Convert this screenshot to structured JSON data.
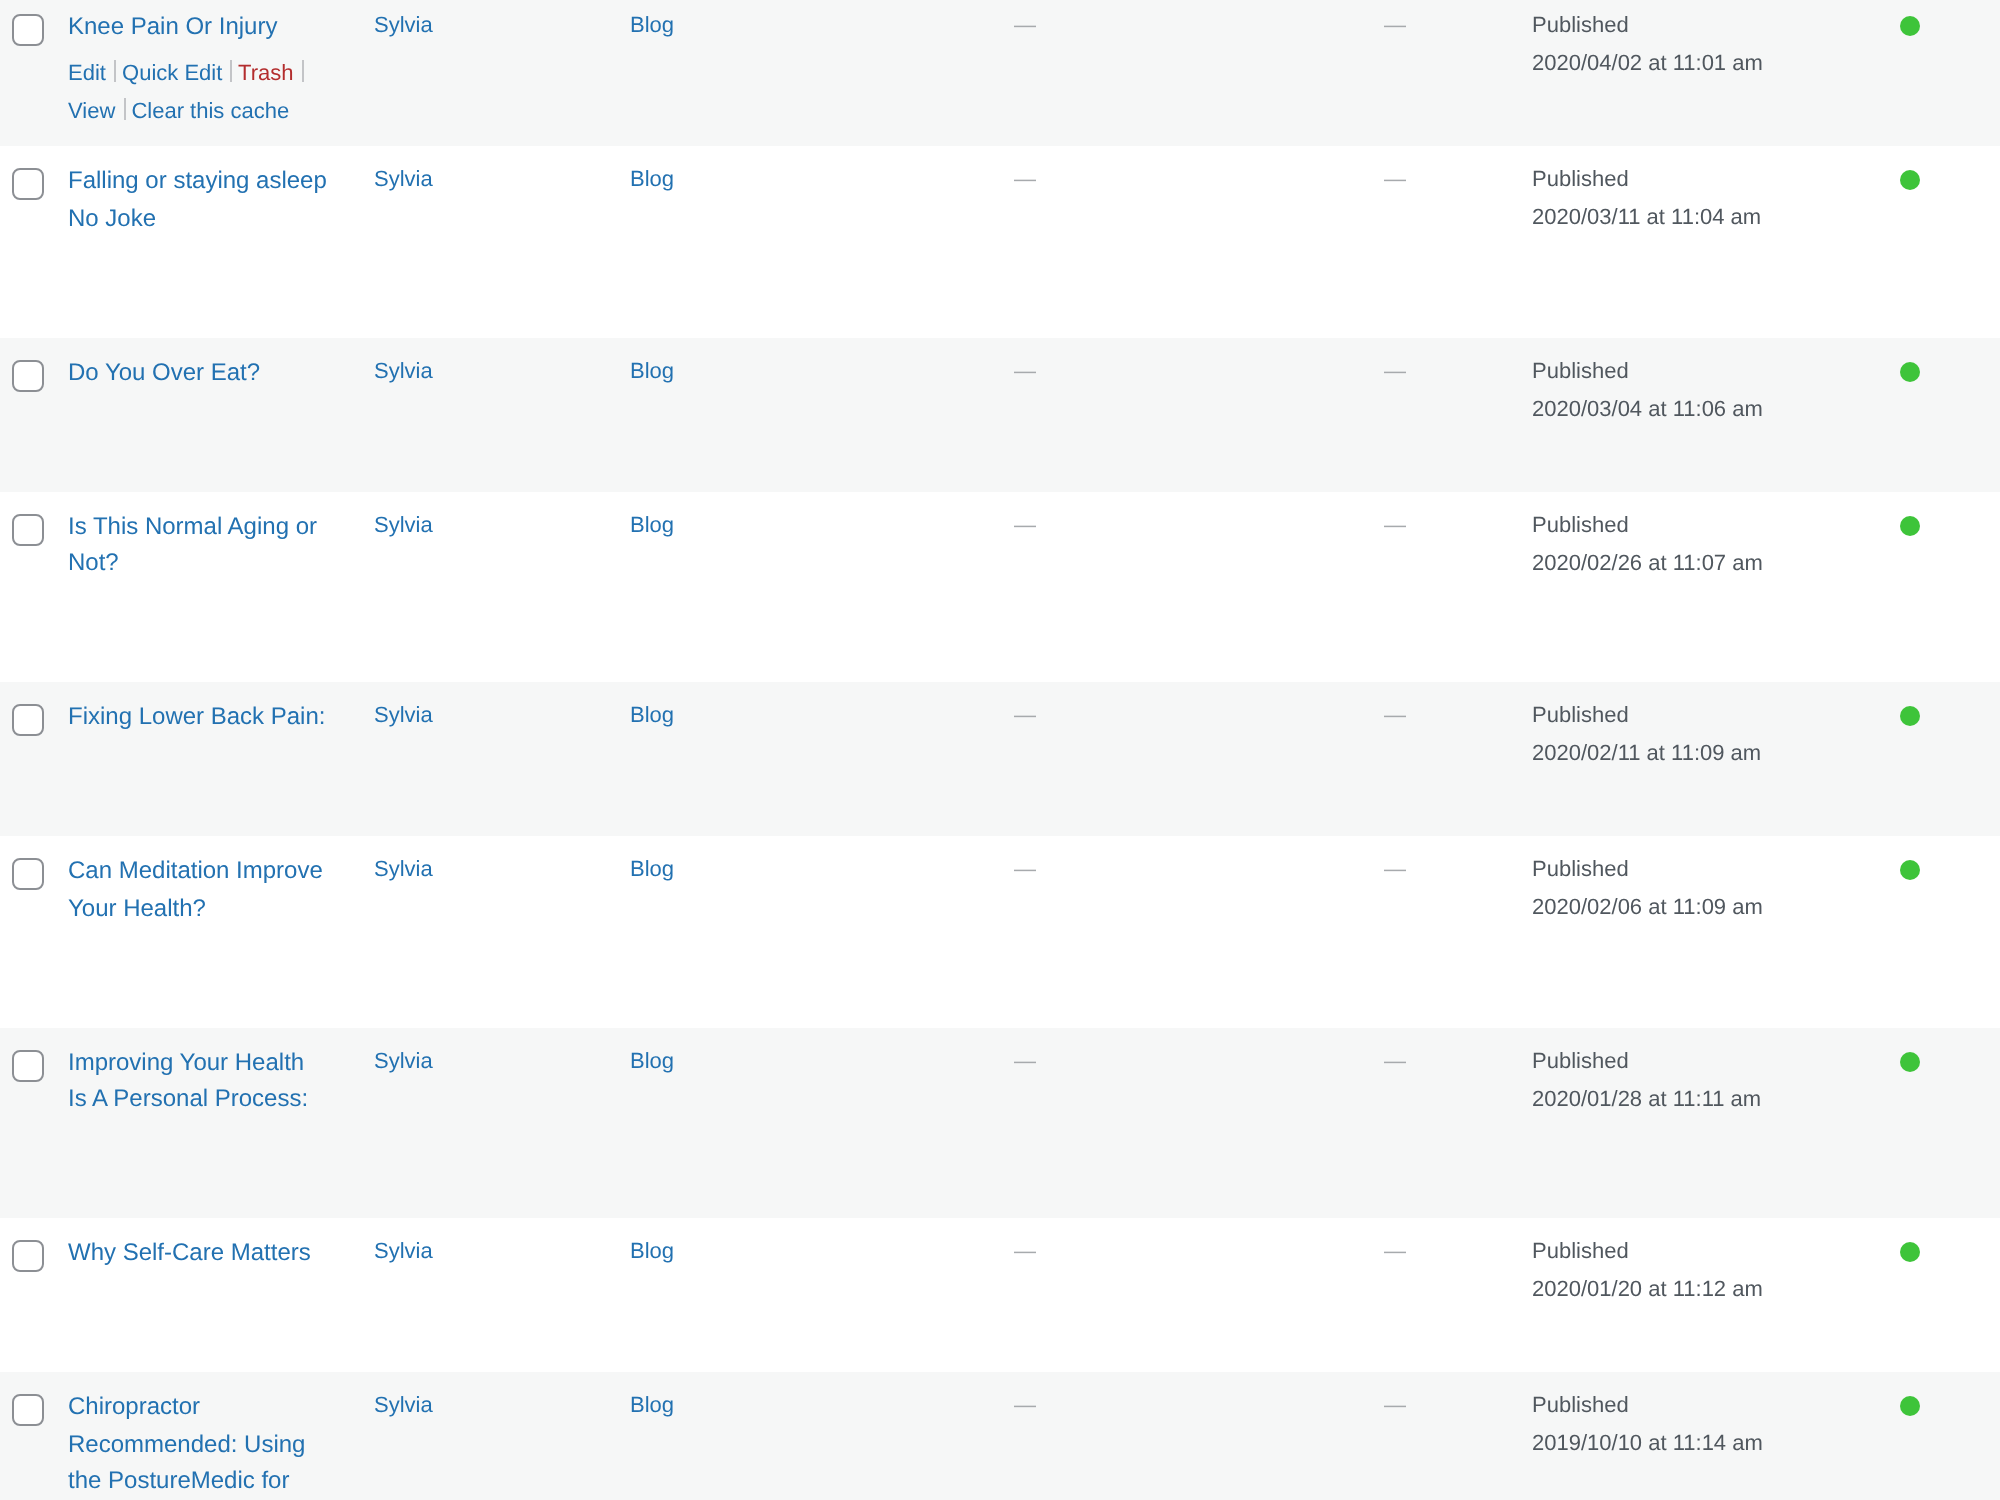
{
  "rows": [
    {
      "checked": false,
      "title": "Knee Pain Or Injury",
      "actions": [
        {
          "label": "Edit",
          "danger": false
        },
        {
          "label": "Quick Edit",
          "danger": false
        },
        {
          "label": "Trash",
          "danger": true
        },
        {
          "label": "View",
          "danger": false
        },
        {
          "label": "Clear this cache",
          "danger": false
        }
      ],
      "column_3": "Sylvia",
      "column_4": "Blog",
      "column_5": "—",
      "column_6": "—",
      "status": "Published",
      "date": "2020/04/02 at 11:01 am",
      "color": "#3ec43a"
    },
    {
      "checked": false,
      "title": "Falling or staying asleep No Joke",
      "column_3": "Sylvia",
      "column_4": "Blog",
      "column_5": "—",
      "column_6": "—",
      "status": "Published",
      "date": "2020/03/11 at 11:04 am",
      "color": "#3ec43a"
    },
    {
      "checked": false,
      "title": "Do You Over Eat?",
      "column_3": "Sylvia",
      "column_4": "Blog",
      "column_5": "—",
      "column_6": "—",
      "status": "Published",
      "date": "2020/03/04 at 11:06 am",
      "color": "#3ec43a"
    },
    {
      "checked": false,
      "title": "Is This Normal Aging or Not?",
      "column_3": "Sylvia",
      "column_4": "Blog",
      "column_5": "—",
      "column_6": "—",
      "status": "Published",
      "date": "2020/02/26 at 11:07 am",
      "color": "#3ec43a"
    },
    {
      "checked": false,
      "title": "Fixing Lower Back Pain:",
      "column_3": "Sylvia",
      "column_4": "Blog",
      "column_5": "—",
      "column_6": "—",
      "status": "Published",
      "date": "2020/02/11 at 11:09 am",
      "color": "#3ec43a"
    },
    {
      "checked": false,
      "title": "Can Meditation Improve Your Health?",
      "column_3": "Sylvia",
      "column_4": "Blog",
      "column_5": "—",
      "column_6": "—",
      "status": "Published",
      "date": "2020/02/06 at 11:09 am",
      "color": "#3ec43a"
    },
    {
      "checked": false,
      "title": "Improving Your Health Is A Personal Process:",
      "column_3": "Sylvia",
      "column_4": "Blog",
      "column_5": "—",
      "column_6": "—",
      "status": "Published",
      "date": "2020/01/28 at 11:11 am",
      "color": "#3ec43a"
    },
    {
      "checked": false,
      "title": "Why Self-Care Matters",
      "column_3": "Sylvia",
      "column_4": "Blog",
      "column_5": "—",
      "column_6": "—",
      "status": "Published",
      "date": "2020/01/20 at 11:12 am",
      "color": "#3ec43a"
    },
    {
      "checked": false,
      "title": "Chiropractor Recommended: Using the PostureMedic for",
      "column_3": "Sylvia",
      "column_4": "Blog",
      "column_5": "—",
      "column_6": "—",
      "status": "Published",
      "date": "2019/10/10 at 11:14 am",
      "color": "#3ec43a"
    }
  ]
}
